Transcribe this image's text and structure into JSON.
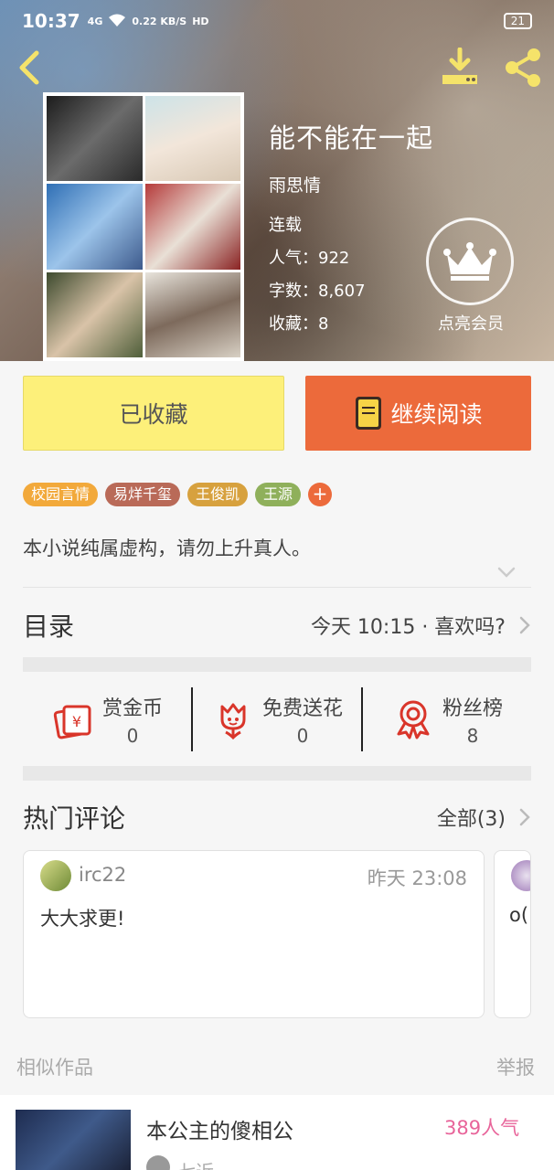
{
  "status_bar": {
    "time": "10:37",
    "network": "4G",
    "speed": "0.22 KB/S",
    "hd": "HD",
    "battery": "21"
  },
  "header": {
    "book_title": "能不能在一起",
    "author": "雨思情",
    "status": "连载",
    "popularity": "人气：922",
    "word_count": "字数：8,607",
    "favorites": "收藏：8",
    "vip_label": "点亮会员"
  },
  "actions": {
    "collected_label": "已收藏",
    "continue_label": "继续阅读"
  },
  "tags": [
    {
      "label": "校园言情",
      "color": "#f2a93b"
    },
    {
      "label": "易烊千玺",
      "color": "#b96a58"
    },
    {
      "label": "王俊凯",
      "color": "#d7a13e"
    },
    {
      "label": "王源",
      "color": "#8fb05b"
    }
  ],
  "description": "本小说纯属虚构，请勿上升真人。",
  "toc": {
    "title": "目录",
    "update": "今天 10:15 · 喜欢吗?"
  },
  "stats": [
    {
      "label": "赏金币",
      "value": "0",
      "icon": "red-envelope-icon"
    },
    {
      "label": "免费送花",
      "value": "0",
      "icon": "flower-icon"
    },
    {
      "label": "粉丝榜",
      "value": "8",
      "icon": "medal-icon"
    }
  ],
  "comments": {
    "title": "热门评论",
    "all_label": "全部(3)",
    "items": [
      {
        "user": "irc22",
        "time": "昨天 23:08",
        "text": "大大求更!"
      },
      {
        "text": "o("
      }
    ]
  },
  "similar": {
    "title": "相似作品",
    "report_label": "举报",
    "items": [
      {
        "title": "本公主的傻相公",
        "popularity": "389人气",
        "author": "七近"
      }
    ]
  },
  "colors": {
    "accent_orange": "#ec6a3b",
    "collected_yellow": "#fdf07a",
    "pink": "#e8649a",
    "icon_red": "#d9352a"
  }
}
